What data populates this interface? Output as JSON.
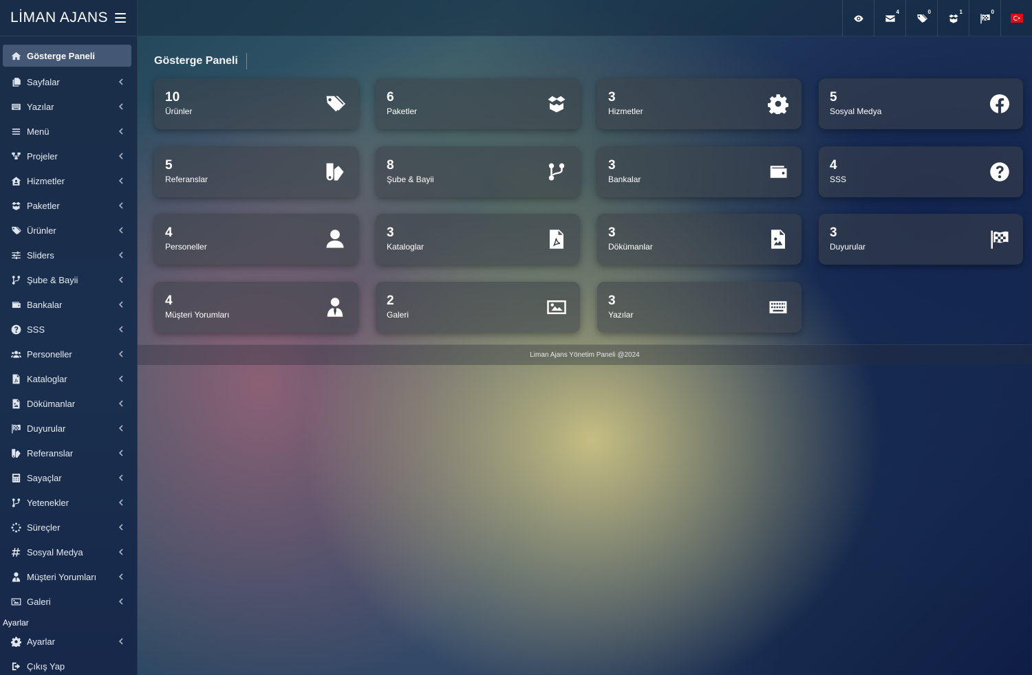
{
  "brand": {
    "name": "LİMAN AJANS"
  },
  "topbar": {
    "icons": [
      {
        "icon": "eye-icon",
        "badge": ""
      },
      {
        "icon": "envelope-icon",
        "badge": "4"
      },
      {
        "icon": "tags-icon",
        "badge": "0"
      },
      {
        "icon": "box-open-icon",
        "badge": "1"
      },
      {
        "icon": "flag-checkered-icon",
        "badge": "0"
      },
      {
        "icon": "turkey-flag-icon",
        "badge": ""
      }
    ]
  },
  "sidebar": {
    "items": [
      {
        "label": "Gösterge Paneli",
        "icon": "home-icon",
        "active": true
      },
      {
        "label": "Sayfalar",
        "icon": "copy-icon"
      },
      {
        "label": "Yazılar",
        "icon": "keyboard-icon"
      },
      {
        "label": "Menü",
        "icon": "bars-icon"
      },
      {
        "label": "Projeler",
        "icon": "sitemap-icon"
      },
      {
        "label": "Hizmetler",
        "icon": "house-user-icon"
      },
      {
        "label": "Paketler",
        "icon": "box-open-icon"
      },
      {
        "label": "Ürünler",
        "icon": "tags-icon"
      },
      {
        "label": "Sliders",
        "icon": "sliders-icon"
      },
      {
        "label": "Şube & Bayii",
        "icon": "code-branch-icon"
      },
      {
        "label": "Bankalar",
        "icon": "wallet-icon"
      },
      {
        "label": "SSS",
        "icon": "question-circle-icon"
      },
      {
        "label": "Personeller",
        "icon": "users-icon"
      },
      {
        "label": "Kataloglar",
        "icon": "file-pdf-icon"
      },
      {
        "label": "Dökümanlar",
        "icon": "file-image-icon"
      },
      {
        "label": "Duyurular",
        "icon": "flag-checkered-icon"
      },
      {
        "label": "Referanslar",
        "icon": "swatchbook-icon"
      },
      {
        "label": "Sayaçlar",
        "icon": "calculator-icon"
      },
      {
        "label": "Yetenekler",
        "icon": "code-branch-icon"
      },
      {
        "label": "Süreçler",
        "icon": "spinner-icon"
      },
      {
        "label": "Sosyal Medya",
        "icon": "hashtag-icon"
      },
      {
        "label": "Müşteri Yorumları",
        "icon": "user-tie-icon"
      },
      {
        "label": "Galeri",
        "icon": "image-icon"
      }
    ],
    "section_label": "Ayarlar",
    "bottom_items": [
      {
        "label": "Ayarlar",
        "icon": "gear-icon"
      },
      {
        "label": "Çıkış Yap",
        "icon": "sign-out-icon"
      }
    ]
  },
  "main": {
    "title": "Gösterge Paneli",
    "cards": [
      {
        "count": "10",
        "label": "Ürünler",
        "icon": "tags-icon"
      },
      {
        "count": "6",
        "label": "Paketler",
        "icon": "box-open-icon"
      },
      {
        "count": "3",
        "label": "Hizmetler",
        "icon": "gear-icon"
      },
      {
        "count": "5",
        "label": "Sosyal Medya",
        "icon": "facebook-icon"
      },
      {
        "count": "5",
        "label": "Referanslar",
        "icon": "swatchbook-icon"
      },
      {
        "count": "8",
        "label": "Şube & Bayii",
        "icon": "code-branch-icon"
      },
      {
        "count": "3",
        "label": "Bankalar",
        "icon": "wallet-icon"
      },
      {
        "count": "4",
        "label": "SSS",
        "icon": "question-circle-icon"
      },
      {
        "count": "4",
        "label": "Personeller",
        "icon": "user-icon"
      },
      {
        "count": "3",
        "label": "Kataloglar",
        "icon": "file-pdf-icon"
      },
      {
        "count": "3",
        "label": "Dökümanlar",
        "icon": "file-image-icon"
      },
      {
        "count": "3",
        "label": "Duyurular",
        "icon": "flag-checkered-icon"
      },
      {
        "count": "4",
        "label": "Müşteri Yorumları",
        "icon": "user-tie-icon"
      },
      {
        "count": "2",
        "label": "Galeri",
        "icon": "image-icon"
      },
      {
        "count": "3",
        "label": "Yazılar",
        "icon": "keyboard-icon"
      }
    ]
  },
  "footer": {
    "text": "Liman Ajans Yönetim Paneli @2024"
  }
}
